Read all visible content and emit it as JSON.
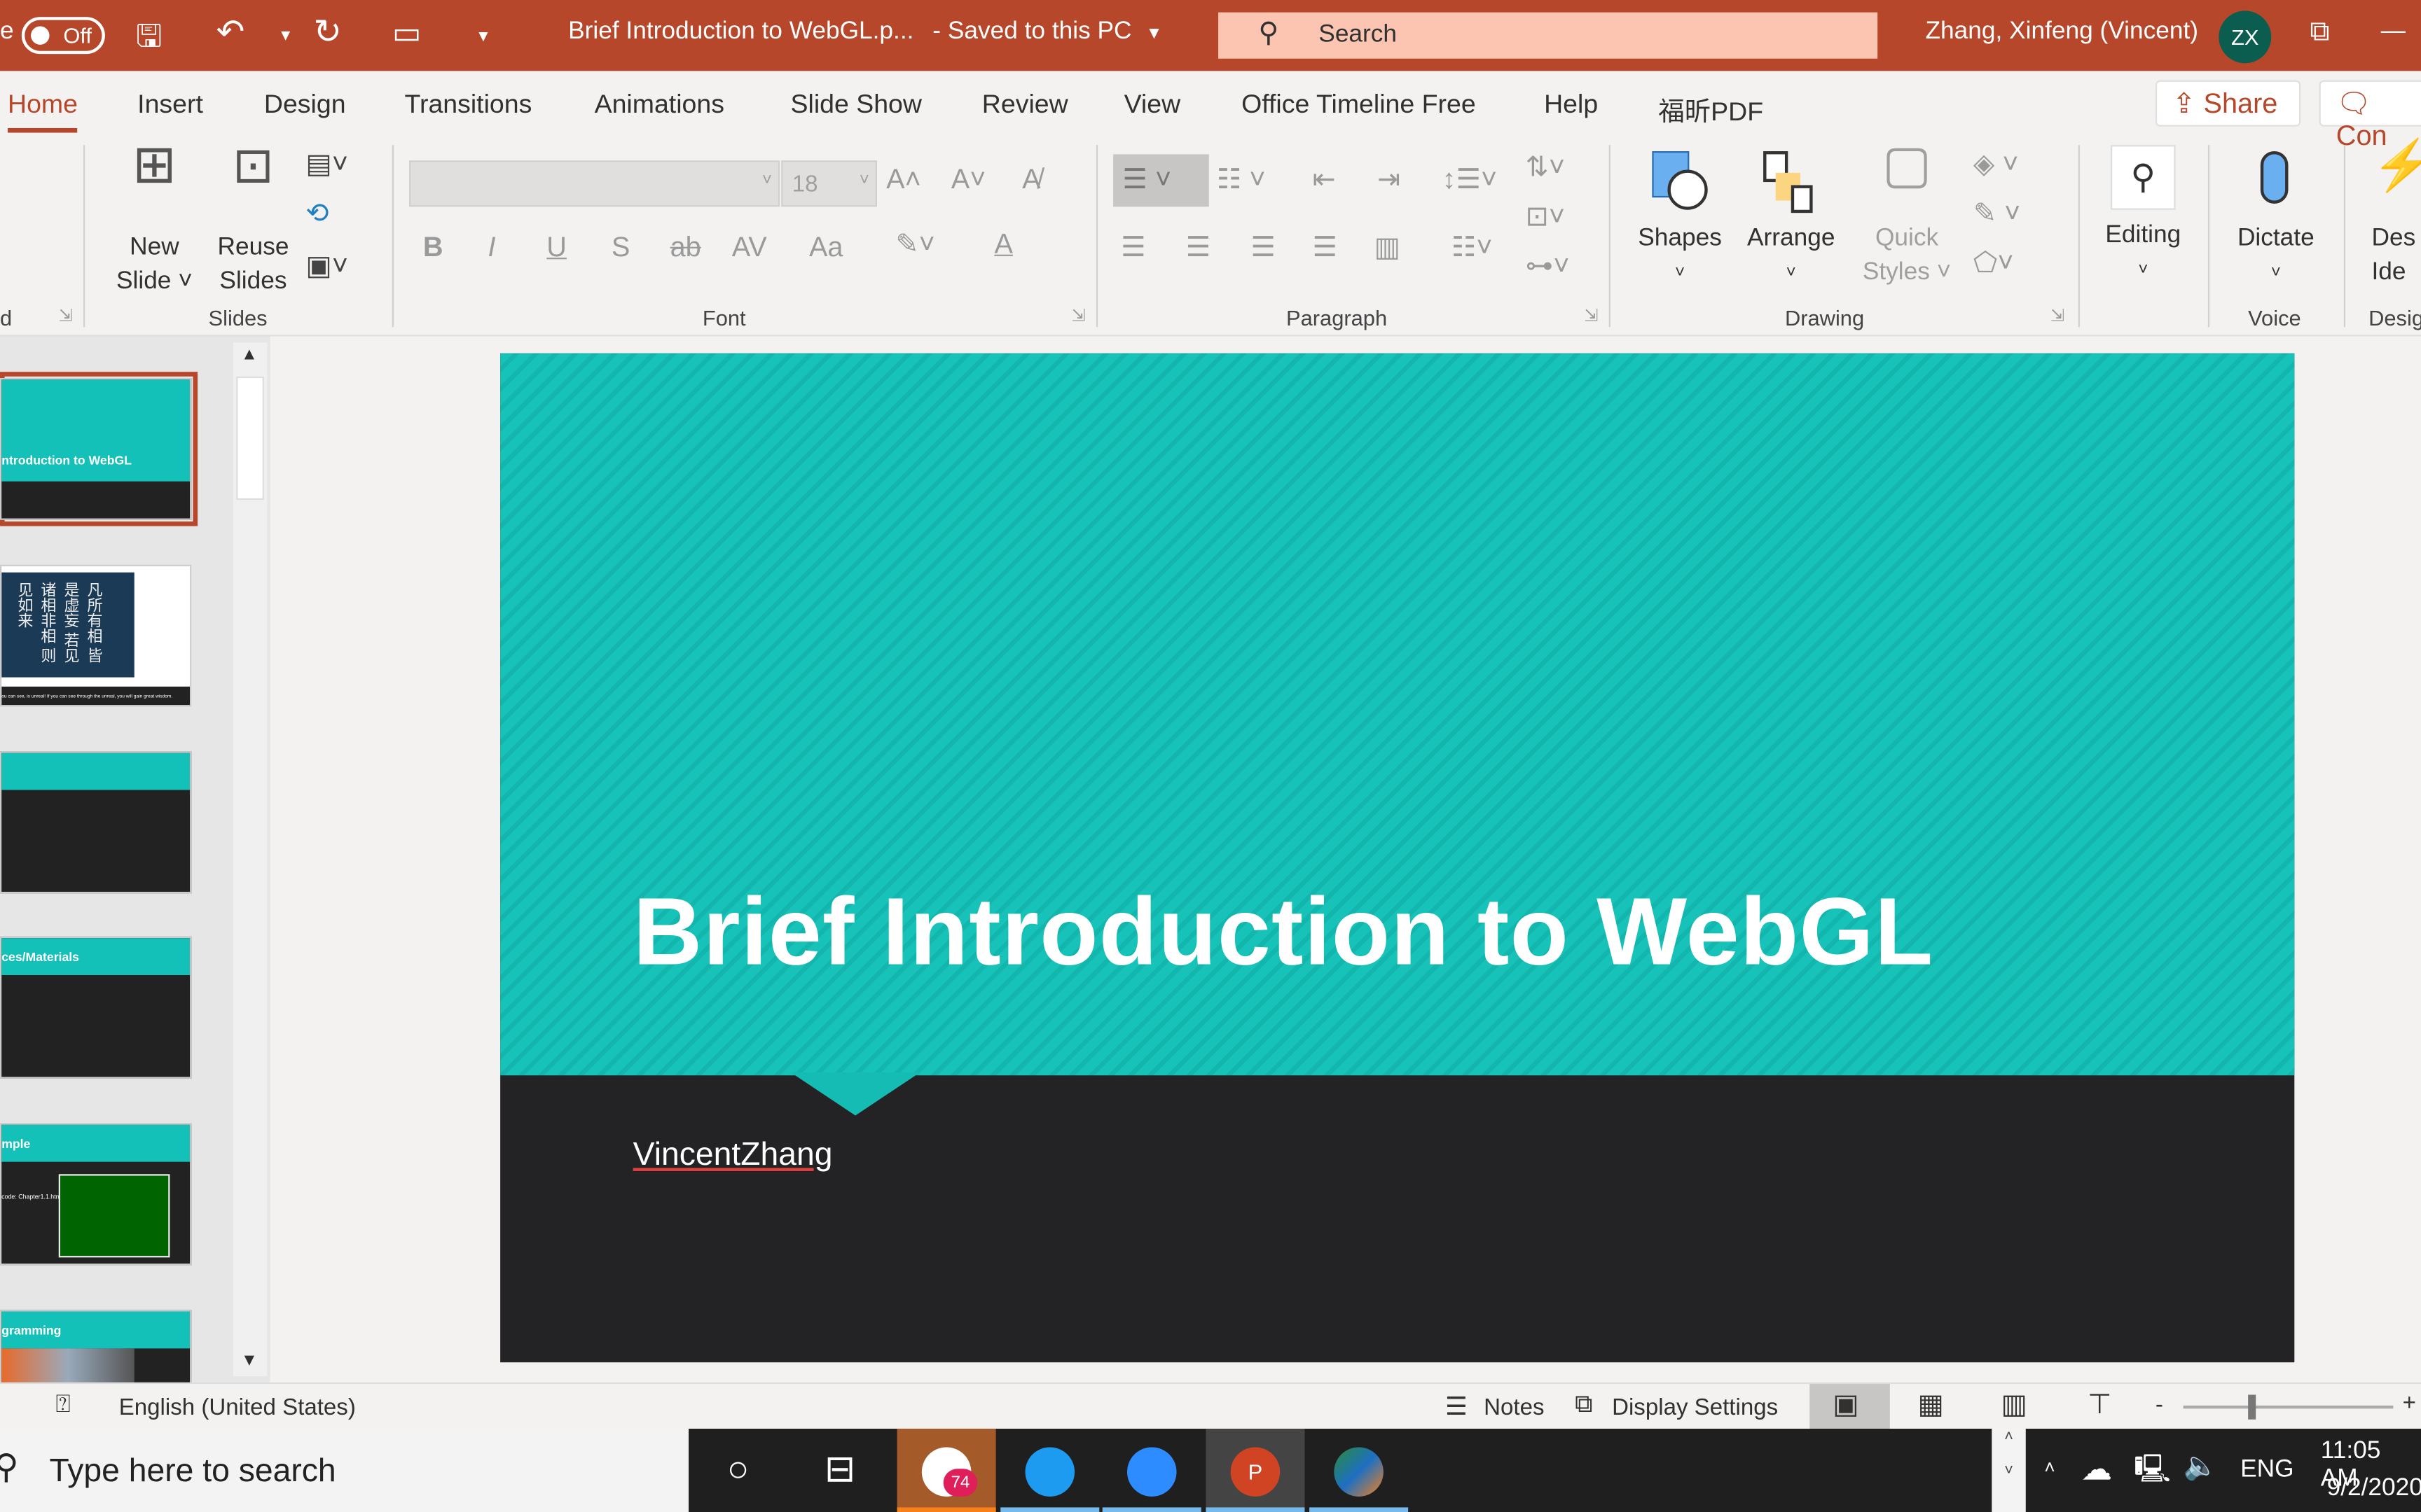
{
  "titlebar": {
    "autosave_label": "Off",
    "autosave_prefix": "e",
    "doc_title": "Brief Introduction to WebGL.p...",
    "save_state": "-  Saved to this PC",
    "search_placeholder": "Search",
    "user_name": "Zhang, Xinfeng (Vincent)",
    "avatar_initials": "ZX"
  },
  "tabs": [
    {
      "label": "Home"
    },
    {
      "label": "Insert"
    },
    {
      "label": "Design"
    },
    {
      "label": "Transitions"
    },
    {
      "label": "Animations"
    },
    {
      "label": "Slide Show"
    },
    {
      "label": "Review"
    },
    {
      "label": "View"
    },
    {
      "label": "Office Timeline Free"
    },
    {
      "label": "Help"
    },
    {
      "label": "福昕PDF"
    }
  ],
  "actions": {
    "share": "Share",
    "comments": "Con"
  },
  "ribbon": {
    "slides": {
      "group": "Slides",
      "new_slide": [
        "New",
        "Slide"
      ],
      "reuse": [
        "Reuse",
        "Slides"
      ]
    },
    "font": {
      "group": "Font",
      "font_name": "",
      "font_size": "18",
      "bold": "B",
      "italic": "I",
      "underline": "U",
      "shadow": "S",
      "strike": "ab",
      "spacing": "AV",
      "case": "Aa",
      "color": "A"
    },
    "paragraph": {
      "group": "Paragraph"
    },
    "drawing": {
      "group": "Drawing",
      "shapes": "Shapes",
      "arrange": "Arrange",
      "quick_styles": [
        "Quick",
        "Styles"
      ]
    },
    "editing": {
      "label": "Editing"
    },
    "voice": {
      "group": "Voice",
      "dictate": "Dictate"
    },
    "designer": {
      "group": "Desig",
      "label": [
        "Des",
        "Ide"
      ]
    },
    "clipboard_group": "d"
  },
  "thumbnails": [
    {
      "title": "ntroduction to WebGL",
      "selected": true
    },
    {
      "title": "",
      "caption": "ou can see, is unreal! If you can see through the unreal, you will gain great wisdom."
    },
    {
      "title": ""
    },
    {
      "title": "ces/Materials"
    },
    {
      "title": "mple",
      "caption": "code: Chapter1.1.html"
    },
    {
      "title": "gramming"
    }
  ],
  "slide": {
    "title": "Brief Introduction to WebGL",
    "subtitle": "VincentZhang",
    "colors": {
      "teal": "#17c3b9",
      "dark": "#232225"
    }
  },
  "status": {
    "language": "English (United States)",
    "notes": "Notes",
    "display_settings": "Display Settings"
  },
  "taskbar": {
    "search_placeholder": "Type here to search",
    "slack_badge": "74",
    "time": "11:05 AM",
    "date": "9/2/2020",
    "lang": "ENG"
  },
  "colors": {
    "accent": "#b7472a"
  }
}
